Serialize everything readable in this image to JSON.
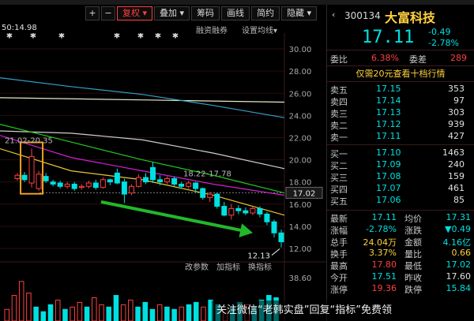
{
  "toolbar": {
    "plus": "+",
    "minus": "−",
    "fuquan": "复权",
    "diejia": "叠加",
    "chouma": "筹码",
    "huaxian": "画线",
    "jianyue": "简约",
    "yincang": "隐藏"
  },
  "info": {
    "ma_text": "50:14.98",
    "rzrq": "融资融券",
    "ma_setting": "设置均线"
  },
  "sub_toolbar": {
    "modify_params": "改参数",
    "add_indicator": "加指标",
    "change_indicator": "换指标"
  },
  "stock": {
    "code": "300134",
    "name": "大富科技",
    "price": "17.11",
    "change": "-0.49",
    "change_pct": "-2.78%"
  },
  "weibi": {
    "label": "委比",
    "value": "6.38%",
    "diff_label": "委差",
    "diff_value": "289"
  },
  "level2_link": "仅需20元查看十档行情",
  "orderbook": {
    "asks": [
      {
        "label": "卖五",
        "price": "17.15",
        "vol": "353"
      },
      {
        "label": "卖四",
        "price": "17.14",
        "vol": "97"
      },
      {
        "label": "卖三",
        "price": "17.13",
        "vol": "303"
      },
      {
        "label": "卖二",
        "price": "17.12",
        "vol": "939"
      },
      {
        "label": "卖一",
        "price": "17.11",
        "vol": "427"
      }
    ],
    "bids": [
      {
        "label": "买一",
        "price": "17.10",
        "vol": "1463"
      },
      {
        "label": "买二",
        "price": "17.09",
        "vol": "240"
      },
      {
        "label": "买三",
        "price": "17.08",
        "vol": "159"
      },
      {
        "label": "买四",
        "price": "17.07",
        "vol": "461"
      },
      {
        "label": "买五",
        "price": "17.06",
        "vol": "85"
      }
    ]
  },
  "stats": [
    {
      "l1": "最新",
      "v1": "17.11",
      "c1": "#00e0e0",
      "l2": "均价",
      "v2": "17.31",
      "c2": "#00e0e0"
    },
    {
      "l1": "涨幅",
      "v1": "-2.78%",
      "c1": "#00e0e0",
      "l2": "涨跌",
      "v2": "▼0.49",
      "c2": "#00e0e0"
    },
    {
      "l1": "总手",
      "v1": "24.04万",
      "c1": "#ffd23c",
      "l2": "金额",
      "v2": "4.16亿",
      "c2": "#00e0e0"
    },
    {
      "l1": "换手",
      "v1": "3.37%",
      "c1": "#ffd23c",
      "l2": "量比",
      "v2": "0.66",
      "c2": "#ffd23c"
    },
    {
      "l1": "最高",
      "v1": "17.80",
      "c1": "#ff4040",
      "l2": "最低",
      "v2": "17.02",
      "c2": "#00e0e0"
    },
    {
      "l1": "今开",
      "v1": "17.51",
      "c1": "#00e0e0",
      "l2": "昨收",
      "v2": "17.60",
      "c2": "#e0e0e0"
    },
    {
      "l1": "涨停",
      "v1": "19.36",
      "c1": "#ff4040",
      "l2": "跌停",
      "v2": "15.84",
      "c2": "#00e0e0"
    }
  ],
  "watermark": "关注微信“老韩实盘”回复“指标”免费领",
  "colors": {
    "up": "#ff4040",
    "down": "#00e0e0",
    "accent": "#ffd23c",
    "arrow": "#22b82a",
    "highlight_box": "#f0a020"
  },
  "chart_data": {
    "type": "candlestick",
    "y_ticks": [
      "30.00",
      "28.00",
      "26.00",
      "24.00",
      "22.00",
      "20.00",
      "18.00",
      "16.00",
      "14.00",
      "12.00"
    ],
    "ylim": [
      11.5,
      31
    ],
    "current_price_label": "17.02",
    "annotations": {
      "high_label": "21.02-20.35",
      "mid_label": "18.22-17.78",
      "low_label": "12.13"
    },
    "candles": [
      {
        "o": 18.3,
        "c": 18.6,
        "h": 18.8,
        "l": 18.1
      },
      {
        "o": 18.6,
        "c": 18.2,
        "h": 18.9,
        "l": 18.0
      },
      {
        "o": 17.9,
        "c": 20.3,
        "h": 21.0,
        "l": 17.5
      },
      {
        "o": 17.4,
        "c": 18.7,
        "h": 19.0,
        "l": 17.2
      },
      {
        "o": 18.5,
        "c": 18.1,
        "h": 18.8,
        "l": 17.9
      },
      {
        "o": 18.0,
        "c": 17.8,
        "h": 18.2,
        "l": 17.6
      },
      {
        "o": 17.9,
        "c": 17.6,
        "h": 18.1,
        "l": 17.4
      },
      {
        "o": 17.6,
        "c": 17.8,
        "h": 18.0,
        "l": 17.4
      },
      {
        "o": 17.8,
        "c": 17.4,
        "h": 18.0,
        "l": 17.2
      },
      {
        "o": 17.5,
        "c": 17.6,
        "h": 17.8,
        "l": 17.3
      },
      {
        "o": 17.6,
        "c": 17.9,
        "h": 18.1,
        "l": 17.4
      },
      {
        "o": 17.9,
        "c": 17.5,
        "h": 18.2,
        "l": 17.3
      },
      {
        "o": 17.5,
        "c": 18.2,
        "h": 18.4,
        "l": 17.4
      },
      {
        "o": 18.2,
        "c": 18.0,
        "h": 18.3,
        "l": 17.7
      },
      {
        "o": 18.8,
        "c": 17.9,
        "h": 19.2,
        "l": 17.8
      },
      {
        "o": 18.0,
        "c": 16.9,
        "h": 18.3,
        "l": 16.1
      },
      {
        "o": 17.0,
        "c": 17.6,
        "h": 17.8,
        "l": 16.8
      },
      {
        "o": 17.6,
        "c": 18.4,
        "h": 18.7,
        "l": 17.5
      },
      {
        "o": 18.4,
        "c": 18.0,
        "h": 18.8,
        "l": 17.8
      },
      {
        "o": 19.3,
        "c": 18.2,
        "h": 19.8,
        "l": 17.9
      },
      {
        "o": 18.2,
        "c": 18.0,
        "h": 18.6,
        "l": 17.7
      },
      {
        "o": 18.0,
        "c": 18.3,
        "h": 18.5,
        "l": 17.8
      },
      {
        "o": 18.3,
        "c": 17.8,
        "h": 18.5,
        "l": 17.6
      },
      {
        "o": 17.8,
        "c": 17.6,
        "h": 18.0,
        "l": 17.4
      },
      {
        "o": 17.6,
        "c": 17.9,
        "h": 18.1,
        "l": 17.4
      },
      {
        "o": 17.9,
        "c": 17.4,
        "h": 18.0,
        "l": 17.0
      },
      {
        "o": 17.4,
        "c": 16.6,
        "h": 17.5,
        "l": 16.4
      },
      {
        "o": 16.6,
        "c": 16.9,
        "h": 17.1,
        "l": 16.2
      },
      {
        "o": 16.9,
        "c": 15.8,
        "h": 17.0,
        "l": 15.6
      },
      {
        "o": 15.8,
        "c": 15.0,
        "h": 16.2,
        "l": 14.9
      },
      {
        "o": 15.0,
        "c": 15.6,
        "h": 16.0,
        "l": 14.6
      },
      {
        "o": 15.6,
        "c": 15.4,
        "h": 15.9,
        "l": 15.1
      },
      {
        "o": 15.4,
        "c": 15.2,
        "h": 15.7,
        "l": 15.0
      },
      {
        "o": 15.2,
        "c": 15.6,
        "h": 15.8,
        "l": 15.0
      },
      {
        "o": 15.6,
        "c": 15.1,
        "h": 15.8,
        "l": 14.8
      },
      {
        "o": 15.1,
        "c": 14.4,
        "h": 15.3,
        "l": 14.1
      },
      {
        "o": 14.4,
        "c": 13.4,
        "h": 14.6,
        "l": 13.0
      },
      {
        "o": 13.4,
        "c": 12.6,
        "h": 13.7,
        "l": 12.1
      }
    ],
    "ma_lines": [
      {
        "color": "#e8e8c8",
        "values": [
          25.6,
          25.5,
          25.4,
          25.3,
          25.2
        ]
      },
      {
        "color": "#33a0c8",
        "values": [
          27.4,
          26.6,
          25.9,
          24.9,
          23.8
        ]
      },
      {
        "color": "#cfcfcf",
        "values": [
          22.6,
          22.4,
          21.8,
          20.6,
          19.2
        ]
      },
      {
        "color": "#22c822",
        "values": [
          23.2,
          21.6,
          20.0,
          18.6,
          17.0
        ]
      },
      {
        "color": "#d020d0",
        "values": [
          22.2,
          20.2,
          19.0,
          17.8,
          16.8
        ]
      },
      {
        "color": "#e8c830",
        "values": [
          21.0,
          19.0,
          18.2,
          16.8,
          15.0
        ]
      }
    ],
    "volume": {
      "right_label": "38.60",
      "bars": [
        {
          "v": 0.25,
          "up": true
        },
        {
          "v": 0.55,
          "up": true
        },
        {
          "v": 0.85,
          "up": true
        },
        {
          "v": 0.6,
          "up": true
        },
        {
          "v": 0.3,
          "up": false
        },
        {
          "v": 0.2,
          "up": false
        },
        {
          "v": 0.35,
          "up": false
        },
        {
          "v": 0.45,
          "up": true
        },
        {
          "v": 0.25,
          "up": false
        },
        {
          "v": 0.3,
          "up": true
        },
        {
          "v": 0.4,
          "up": true
        },
        {
          "v": 0.3,
          "up": false
        },
        {
          "v": 0.5,
          "up": true
        },
        {
          "v": 0.35,
          "up": true
        },
        {
          "v": 0.3,
          "up": false
        },
        {
          "v": 0.55,
          "up": false
        },
        {
          "v": 0.35,
          "up": true
        },
        {
          "v": 0.45,
          "up": true
        },
        {
          "v": 0.3,
          "up": false
        },
        {
          "v": 0.4,
          "up": false
        },
        {
          "v": 0.25,
          "up": false
        },
        {
          "v": 0.35,
          "up": true
        },
        {
          "v": 0.3,
          "up": false
        },
        {
          "v": 0.25,
          "up": false
        },
        {
          "v": 0.3,
          "up": true
        },
        {
          "v": 0.35,
          "up": false
        },
        {
          "v": 0.4,
          "up": false
        },
        {
          "v": 0.3,
          "up": true
        },
        {
          "v": 0.45,
          "up": false
        },
        {
          "v": 0.35,
          "up": false
        },
        {
          "v": 0.25,
          "up": true
        },
        {
          "v": 0.3,
          "up": false
        },
        {
          "v": 0.4,
          "up": false
        },
        {
          "v": 0.35,
          "up": true
        },
        {
          "v": 0.3,
          "up": false
        },
        {
          "v": 0.45,
          "up": false
        },
        {
          "v": 0.55,
          "up": false
        },
        {
          "v": 0.5,
          "up": false
        }
      ]
    }
  }
}
